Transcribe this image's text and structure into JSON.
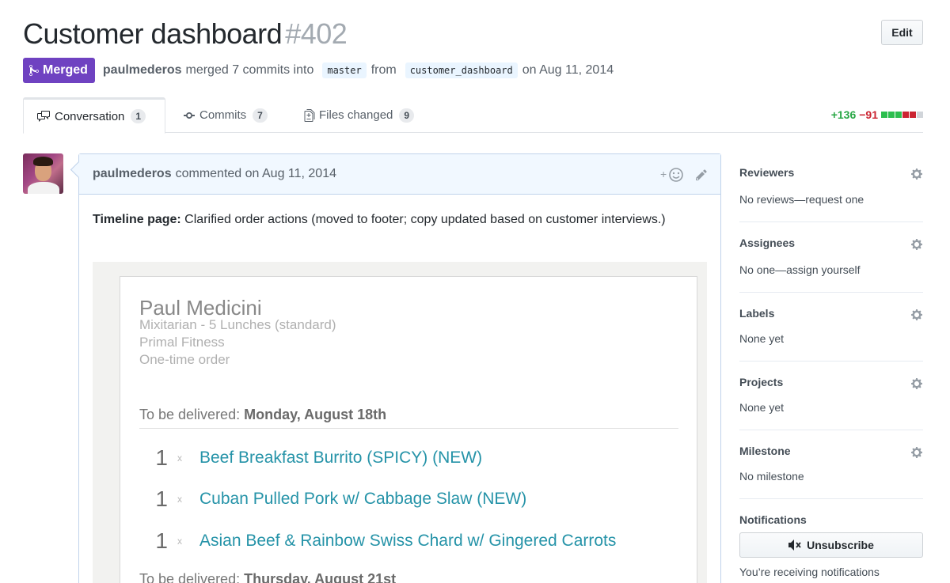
{
  "header": {
    "title": "Customer dashboard",
    "number": "#402",
    "edit_label": "Edit"
  },
  "meta": {
    "status": "Merged",
    "author": "paulmederos",
    "text_merged": "merged 7 commits into",
    "base_branch": "master",
    "text_from": "from",
    "head_branch": "customer_dashboard",
    "text_date": "on Aug 11, 2014"
  },
  "tabs": [
    {
      "label": "Conversation",
      "count": "1"
    },
    {
      "label": "Commits",
      "count": "7"
    },
    {
      "label": "Files changed",
      "count": "9"
    }
  ],
  "diffstat": {
    "additions": "+136",
    "deletions": "−91",
    "blocks": [
      "#2cbe4e",
      "#2cbe4e",
      "#2cbe4e",
      "#cb2431",
      "#cb2431",
      "#d1d5da"
    ]
  },
  "comment": {
    "author": "paulmederos",
    "meta": "commented on Aug 11, 2014",
    "body_bold": "Timeline page:",
    "body_text": " Clarified order actions (moved to footer; copy updated based on customer interviews.)"
  },
  "screenshot": {
    "customer_name": "Paul Medicini",
    "plan": "Mixitarian - 5 Lunches (standard)",
    "gym": "Primal Fitness",
    "order_type": "One-time order",
    "delivery1_label": "To be delivered: ",
    "delivery1_date": "Monday, August 18th",
    "items": [
      {
        "qty": "1",
        "x": "x",
        "name": "Beef Breakfast Burrito (SPICY) (NEW)"
      },
      {
        "qty": "1",
        "x": "x",
        "name": "Cuban Pulled Pork w/ Cabbage Slaw (NEW)"
      },
      {
        "qty": "1",
        "x": "x",
        "name": "Asian Beef & Rainbow Swiss Chard w/ Gingered Carrots"
      }
    ],
    "delivery2_label": "To be delivered: ",
    "delivery2_date": "Thursday, August 21st"
  },
  "sidebar": {
    "reviewers": {
      "title": "Reviewers",
      "value": "No reviews—request one"
    },
    "assignees": {
      "title": "Assignees",
      "value": "No one—assign yourself"
    },
    "labels": {
      "title": "Labels",
      "value": "None yet"
    },
    "projects": {
      "title": "Projects",
      "value": "None yet"
    },
    "milestone": {
      "title": "Milestone",
      "value": "No milestone"
    },
    "notifications": {
      "title": "Notifications",
      "button": "Unsubscribe",
      "note": "You’re receiving notifications"
    }
  },
  "icons": {
    "merge": "git-merge-icon",
    "conversation": "comment-discussion-icon",
    "commits": "git-commit-icon",
    "files": "file-diff-icon",
    "reaction": "smiley-icon",
    "edit": "pencil-icon",
    "gear": "gear-icon",
    "mute": "mute-icon"
  }
}
